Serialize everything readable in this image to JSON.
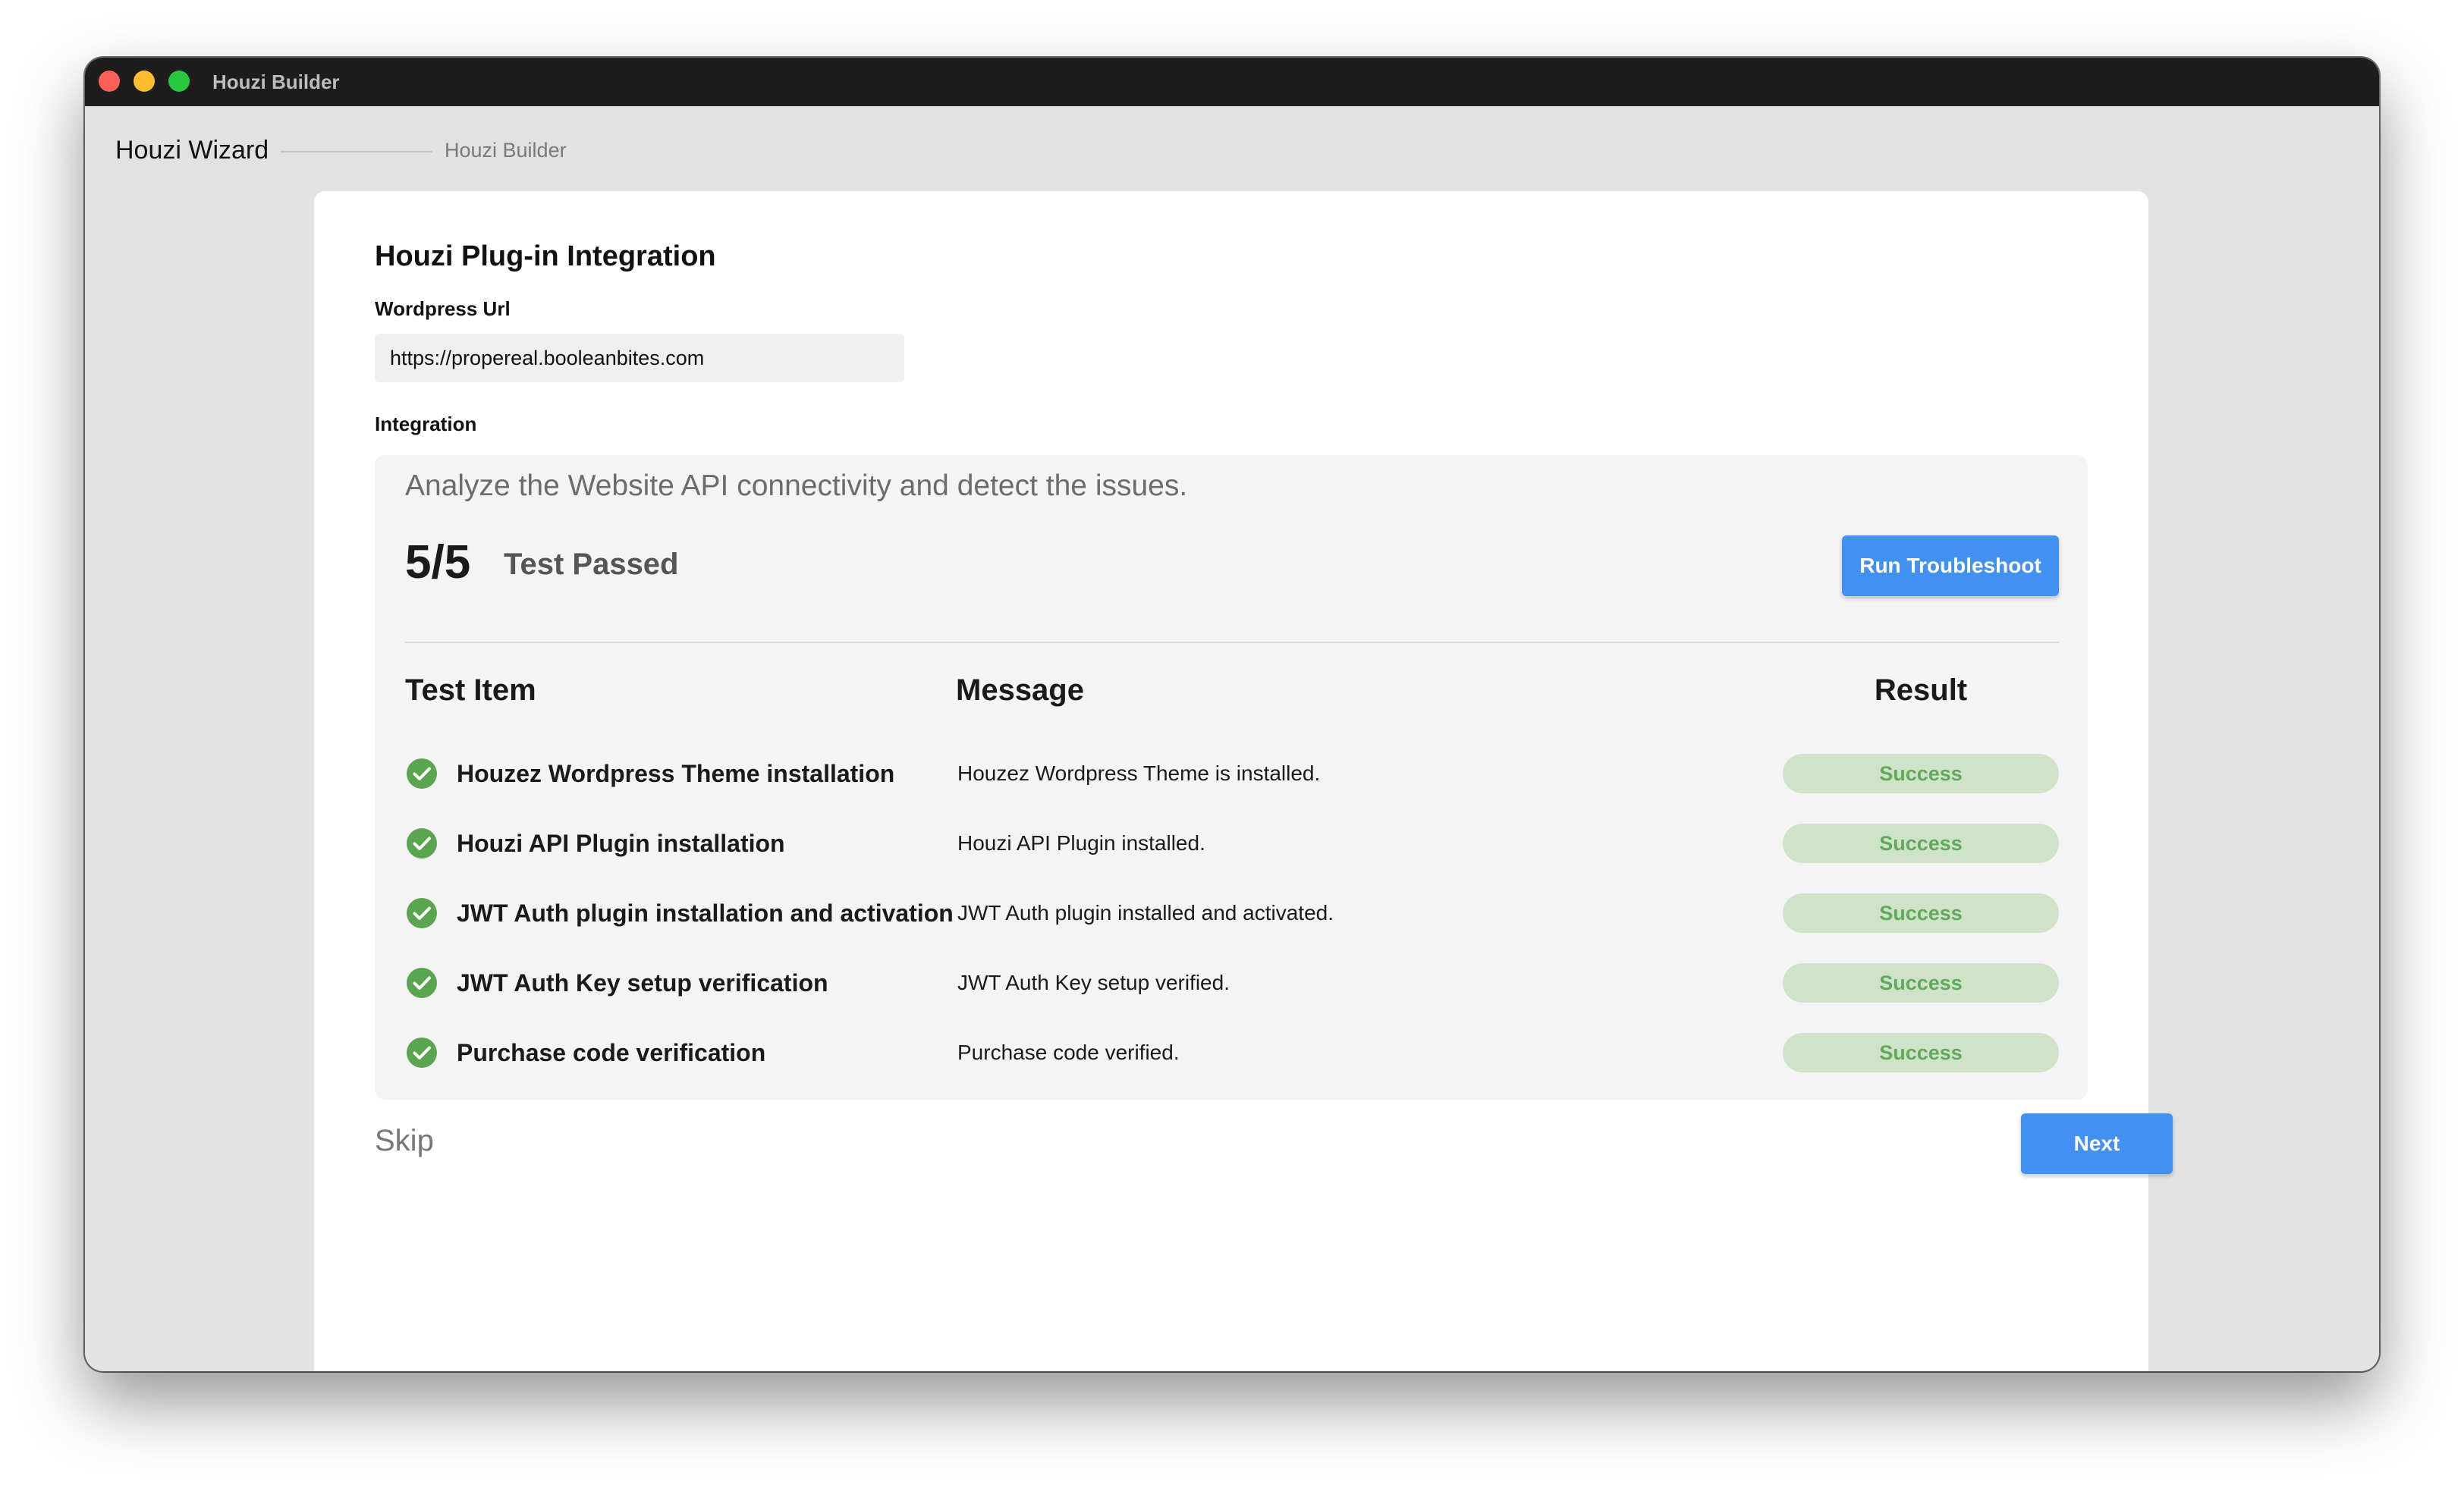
{
  "window": {
    "title": "Houzi Builder"
  },
  "breadcrumb": {
    "root": "Houzi Wizard",
    "current": "Houzi Builder"
  },
  "page": {
    "title": "Houzi Plug-in Integration",
    "wordpress_url_label": "Wordpress Url",
    "wordpress_url_value": "https://propereal.booleanbites.com",
    "integration_label": "Integration"
  },
  "integration": {
    "description": "Analyze the Website API connectivity and detect the issues.",
    "score": "5/5",
    "score_label": "Test Passed",
    "run_button_label": "Run Troubleshoot",
    "columns": {
      "test_item": "Test Item",
      "message": "Message",
      "result": "Result"
    },
    "tests": [
      {
        "item": "Houzez Wordpress Theme installation",
        "message": "Houzez Wordpress Theme is installed.",
        "result": "Success",
        "icon": "check-circle-icon"
      },
      {
        "item": "Houzi API Plugin installation",
        "message": "Houzi API Plugin installed.",
        "result": "Success",
        "icon": "check-circle-icon"
      },
      {
        "item": "JWT Auth plugin installation and activation",
        "message": "JWT Auth plugin installed and activated.",
        "result": "Success",
        "icon": "check-circle-icon"
      },
      {
        "item": "JWT Auth Key setup verification",
        "message": "JWT Auth Key setup verified.",
        "result": "Success",
        "icon": "check-circle-icon"
      },
      {
        "item": "Purchase code verification",
        "message": "Purchase code verified.",
        "result": "Success",
        "icon": "check-circle-icon"
      }
    ]
  },
  "footer": {
    "skip_label": "Skip",
    "next_label": "Next"
  },
  "colors": {
    "primary": "#4290ef",
    "success_text": "#62a95c",
    "success_badge": "#cfe3c9",
    "success_icon": "#5aa650",
    "titlebar": "#1d1d1d",
    "window_bg": "#e2e2e2"
  }
}
